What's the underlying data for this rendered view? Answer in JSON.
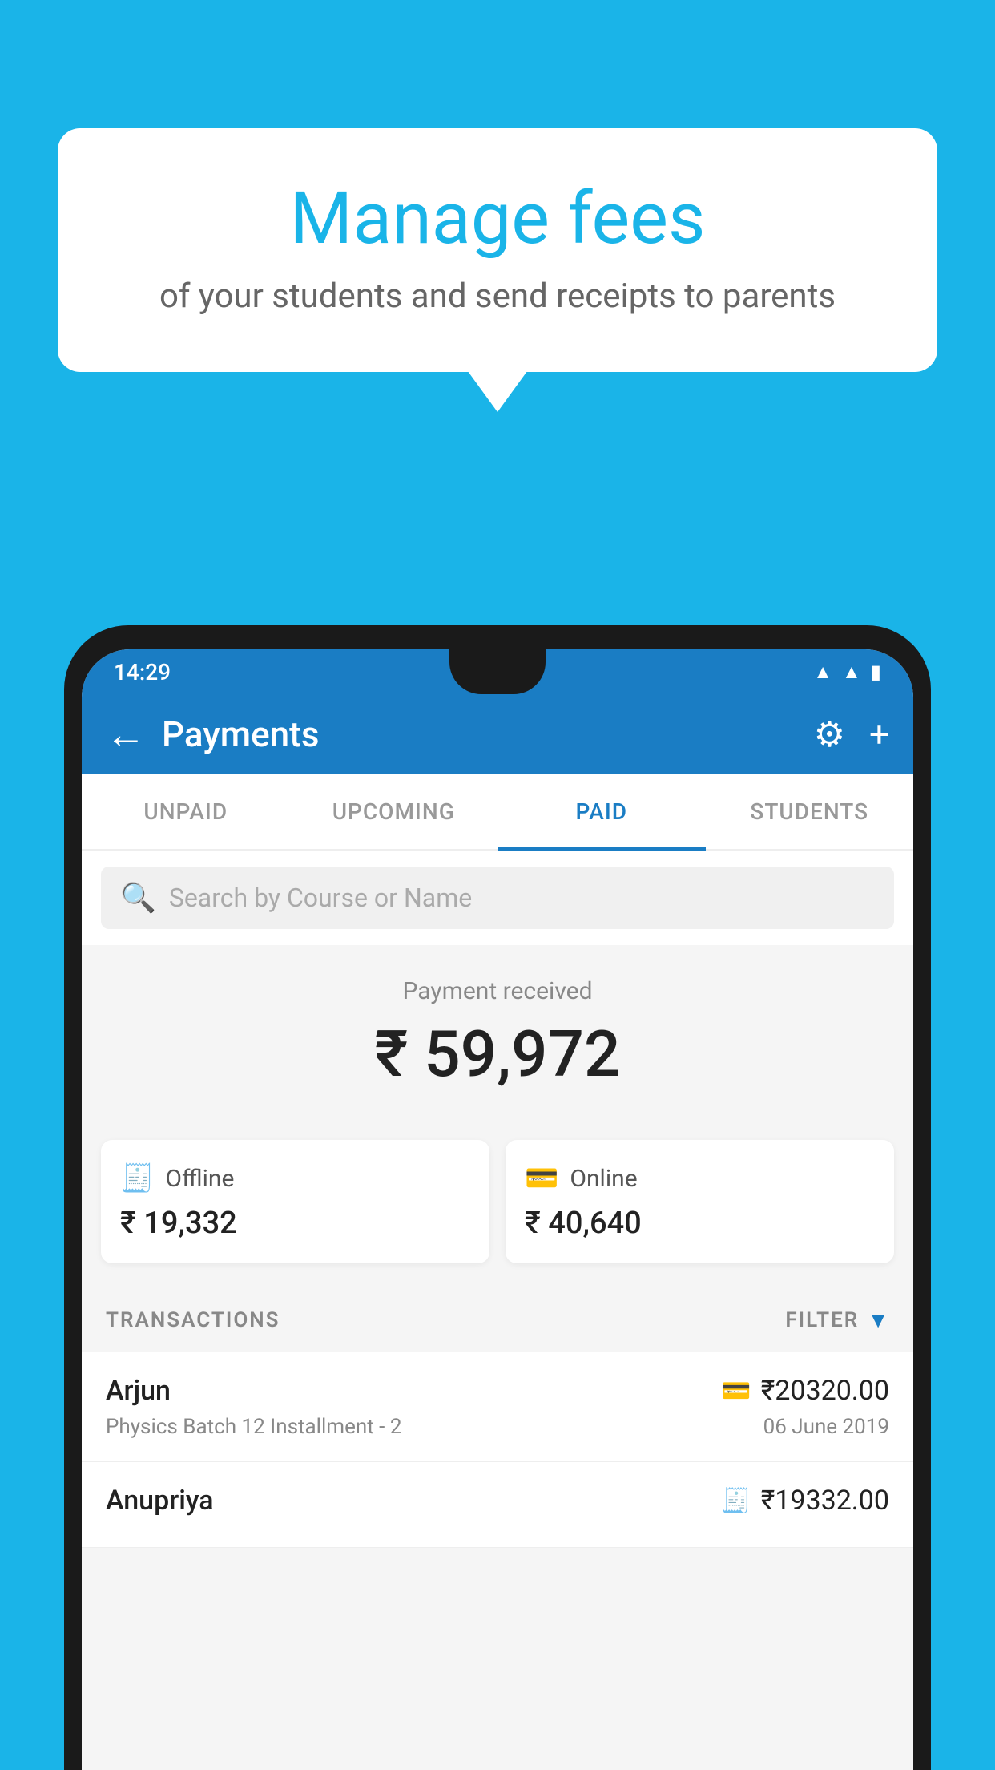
{
  "background": {
    "color": "#1ab4e8"
  },
  "speech_bubble": {
    "title": "Manage fees",
    "subtitle": "of your students and send receipts to parents"
  },
  "status_bar": {
    "time": "14:29",
    "icons": [
      "wifi",
      "signal",
      "battery"
    ]
  },
  "app_bar": {
    "title": "Payments",
    "back_label": "←",
    "settings_label": "⚙",
    "add_label": "+"
  },
  "tabs": [
    {
      "label": "UNPAID",
      "active": false
    },
    {
      "label": "UPCOMING",
      "active": false
    },
    {
      "label": "PAID",
      "active": true
    },
    {
      "label": "STUDENTS",
      "active": false
    }
  ],
  "search": {
    "placeholder": "Search by Course or Name"
  },
  "payment_summary": {
    "label": "Payment received",
    "amount": "₹ 59,972",
    "offline": {
      "icon": "💳",
      "type": "Offline",
      "amount": "₹ 19,332"
    },
    "online": {
      "icon": "💳",
      "type": "Online",
      "amount": "₹ 40,640"
    }
  },
  "transactions": {
    "section_label": "TRANSACTIONS",
    "filter_label": "FILTER",
    "items": [
      {
        "name": "Arjun",
        "course": "Physics Batch 12 Installment - 2",
        "amount": "₹20320.00",
        "date": "06 June 2019",
        "type": "online"
      },
      {
        "name": "Anupriya",
        "course": "",
        "amount": "₹19332.00",
        "date": "",
        "type": "offline"
      }
    ]
  }
}
